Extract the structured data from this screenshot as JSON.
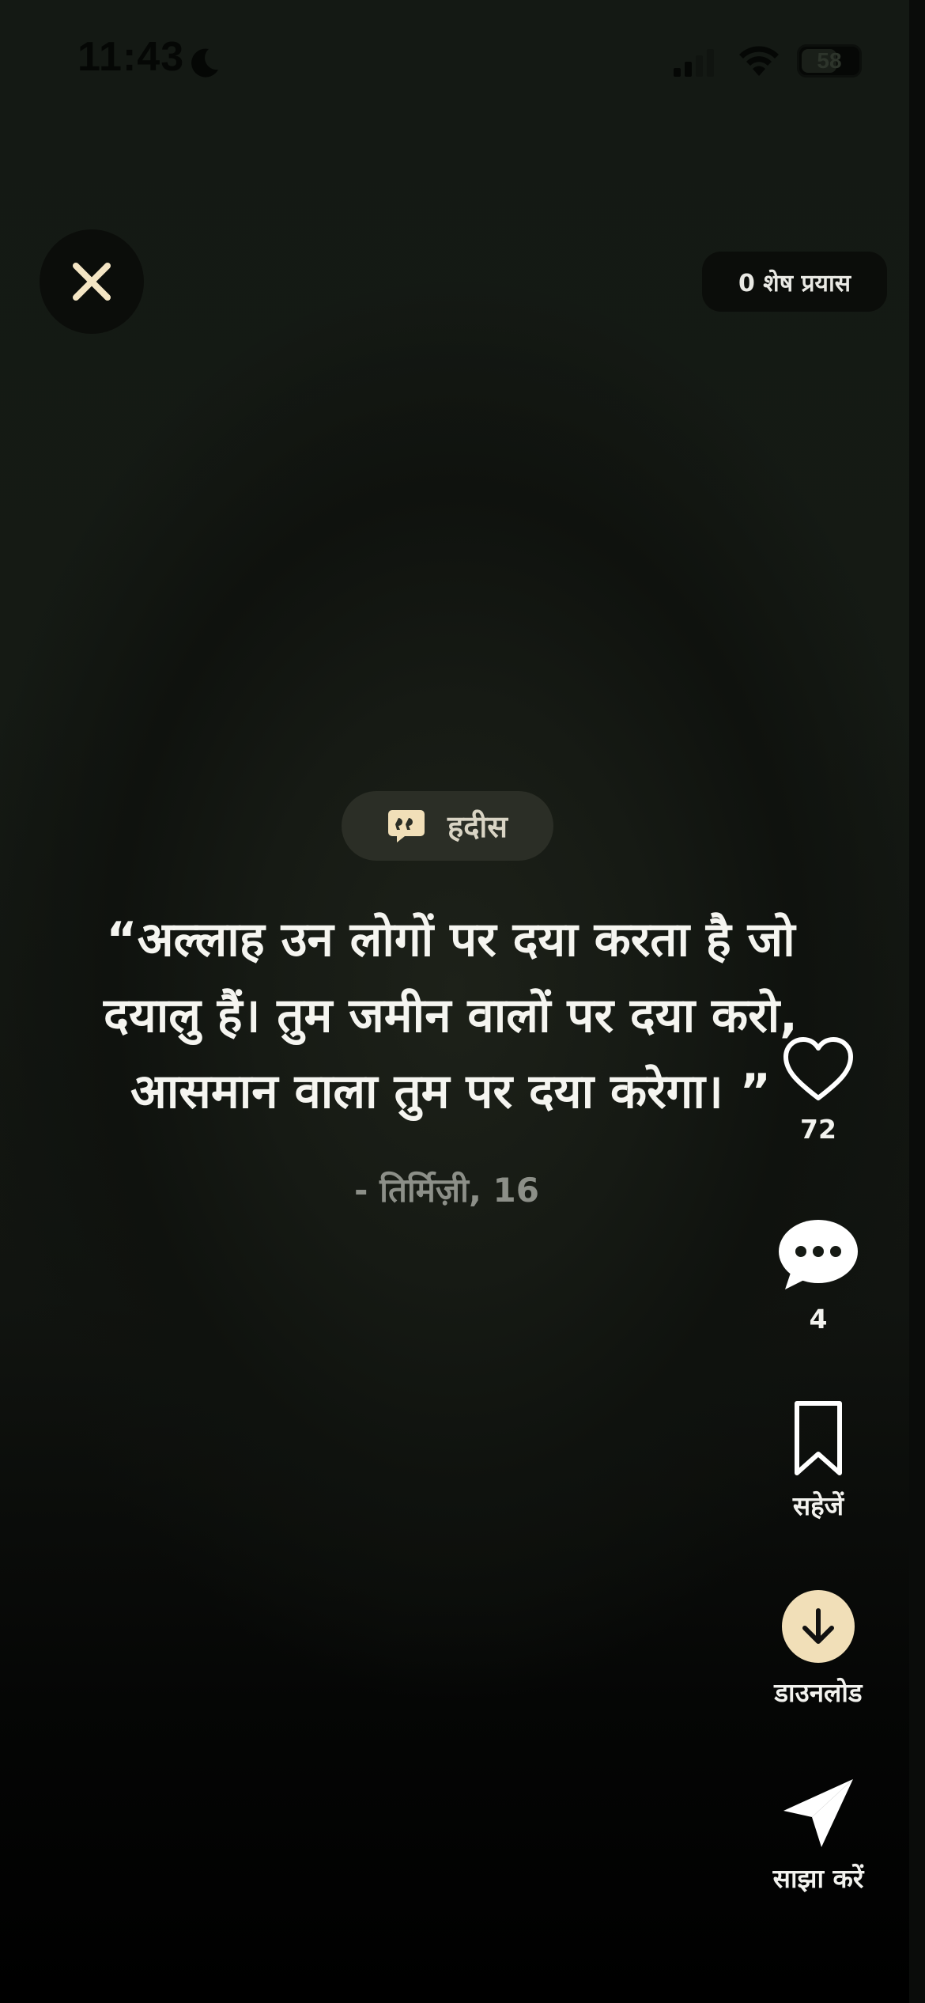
{
  "status_bar": {
    "time": "11:43",
    "battery": "58",
    "icons": [
      "moon-icon",
      "signal-icon",
      "wifi-icon",
      "battery-icon"
    ]
  },
  "header": {
    "close_icon": "close-icon",
    "attempts_label": "0 शेष प्रयास"
  },
  "category": {
    "icon": "quote-bubble-icon",
    "label": "हदीस"
  },
  "quote": {
    "lines": [
      "“अल्लाह उन लोगों पर दया करता है जो",
      "दयालु हैं। तुम जमीन वालों पर दया करो,",
      "आसमान वाला तुम पर दया करेगा। ”"
    ],
    "source": "- तिर्मिज़ी, 16"
  },
  "actions": {
    "like": {
      "icon": "heart-icon",
      "count": "72"
    },
    "comment": {
      "icon": "comment-icon",
      "count": "4"
    },
    "save": {
      "icon": "bookmark-icon",
      "label": "सहेजें"
    },
    "download": {
      "icon": "download-icon",
      "label": "डाउनलोड"
    },
    "share": {
      "icon": "send-icon",
      "label": "साझा करें"
    }
  },
  "colors": {
    "background": "#151a14",
    "accent": "#f1dfb8",
    "text": "#f5f5f0",
    "muted": "#8c8f88"
  }
}
